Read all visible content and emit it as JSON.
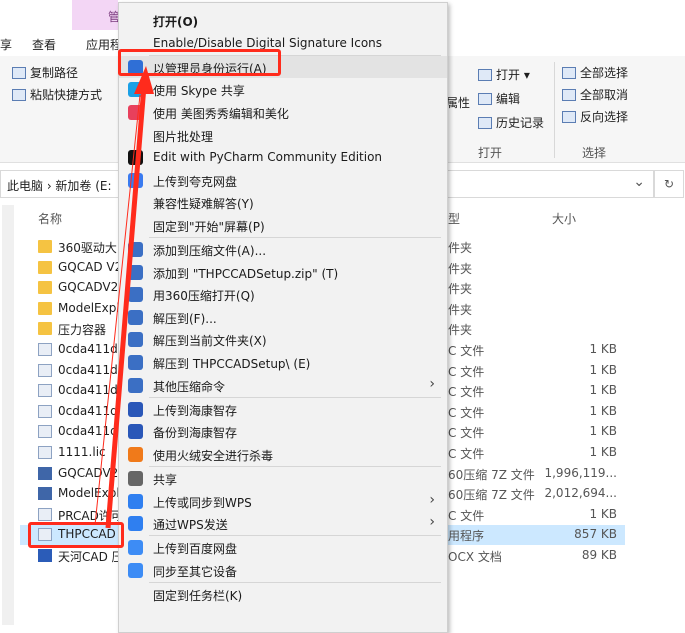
{
  "ribbon": {
    "tabs": {
      "view": "查看",
      "app": "应用程",
      "manage": "管",
      "left_cut": "享"
    },
    "copy_path": "复制路径",
    "paste_shortcut": "粘贴快捷方式",
    "attr_cut": "属性",
    "open": "打开",
    "edit": "编辑",
    "history": "历史记录",
    "select_all": "全部选择",
    "select_none": "全部取消",
    "invert_select": "反向选择",
    "group_open": "打开",
    "group_select": "选择"
  },
  "address": {
    "path": "此电脑 › 新加卷 (E:",
    "refresh": "↻",
    "dropdown": "⌄"
  },
  "columns": {
    "name": "名称",
    "type": "型",
    "size": "大小"
  },
  "files": [
    {
      "name": "360驱动大",
      "type": "件夹",
      "size": "",
      "icon": "folder"
    },
    {
      "name": "GQCAD V2",
      "type": "件夹",
      "size": "",
      "icon": "folder"
    },
    {
      "name": "GQCADV2",
      "type": "件夹",
      "size": "",
      "icon": "folder"
    },
    {
      "name": "ModelExpl",
      "type": "件夹",
      "size": "",
      "icon": "folder"
    },
    {
      "name": "压力容器",
      "type": "件夹",
      "size": "",
      "icon": "folder"
    },
    {
      "name": "0cda411d1",
      "type": "C 文件",
      "size": "1 KB",
      "icon": "doc"
    },
    {
      "name": "0cda411d3",
      "type": "C 文件",
      "size": "1 KB",
      "icon": "doc"
    },
    {
      "name": "0cda411d5",
      "type": "C 文件",
      "size": "1 KB",
      "icon": "doc"
    },
    {
      "name": "0cda411dc",
      "type": "C 文件",
      "size": "1 KB",
      "icon": "doc"
    },
    {
      "name": "0cda411de",
      "type": "C 文件",
      "size": "1 KB",
      "icon": "doc"
    },
    {
      "name": "1111.lic",
      "type": "C 文件",
      "size": "1 KB",
      "icon": "doc"
    },
    {
      "name": "GQCADV24",
      "type": "60压缩 7Z 文件",
      "size": "1,996,119...",
      "icon": "pkg"
    },
    {
      "name": "ModelExpl",
      "type": "60压缩 7Z 文件",
      "size": "2,012,694...",
      "icon": "pkg"
    },
    {
      "name": "PRCAD许可",
      "type": "C 文件",
      "size": "1 KB",
      "icon": "doc"
    },
    {
      "name": "THPCCAD",
      "type": "用程序",
      "size": "857 KB",
      "icon": "doc",
      "selected": true
    },
    {
      "name": "天河CAD 压",
      "type": "OCX 文档",
      "size": "89 KB",
      "icon": "word"
    }
  ],
  "menu": [
    {
      "label": "打开(O)",
      "bold": true,
      "icon": ""
    },
    {
      "label": "Enable/Disable Digital Signature Icons",
      "icon": ""
    },
    {
      "label": "以管理员身份运行(A)",
      "icon": "shield-icon"
    },
    {
      "label": "使用 Skype 共享",
      "icon": "skype-icon"
    },
    {
      "label": "使用 美图秀秀编辑和美化",
      "icon": "meitu-icon"
    },
    {
      "label": "图片批处理",
      "icon": ""
    },
    {
      "label": "Edit with PyCharm Community Edition",
      "icon": "pycharm-icon"
    },
    {
      "label": "上传到夸克网盘",
      "icon": "quark-cloud-icon"
    },
    {
      "label": "兼容性疑难解答(Y)",
      "icon": ""
    },
    {
      "label": "固定到\"开始\"屏幕(P)",
      "icon": ""
    },
    {
      "label": "添加到压缩文件(A)...",
      "icon": "zip-icon"
    },
    {
      "label": "添加到 \"THPCCADSetup.zip\" (T)",
      "icon": "zip-icon"
    },
    {
      "label": "用360压缩打开(Q)",
      "icon": "zip-icon"
    },
    {
      "label": "解压到(F)...",
      "icon": "zip-icon"
    },
    {
      "label": "解压到当前文件夹(X)",
      "icon": "zip-icon"
    },
    {
      "label": "解压到 THPCCADSetup\\ (E)",
      "icon": "zip-icon"
    },
    {
      "label": "其他压缩命令",
      "icon": "zip-icon",
      "submenu": true
    },
    {
      "label": "上传到海康智存",
      "icon": "hik-icon"
    },
    {
      "label": "备份到海康智存",
      "icon": "hik-icon"
    },
    {
      "label": "使用火绒安全进行杀毒",
      "icon": "huorong-icon"
    },
    {
      "label": "共享",
      "icon": "share-icon"
    },
    {
      "label": "上传或同步到WPS",
      "icon": "wps-cloud-icon",
      "submenu": true
    },
    {
      "label": "通过WPS发送",
      "icon": "wps-send-icon",
      "submenu": true
    },
    {
      "label": "上传到百度网盘",
      "icon": "baidu-icon"
    },
    {
      "label": "同步至其它设备",
      "icon": "baidu-sync-icon"
    },
    {
      "label": "固定到任务栏(K)",
      "icon": ""
    }
  ],
  "submenu_arrow": "›",
  "colors": {
    "highlight": "#ff2b1c",
    "menu_bg": "#f2f2f2",
    "selected_row": "#cce8ff"
  }
}
